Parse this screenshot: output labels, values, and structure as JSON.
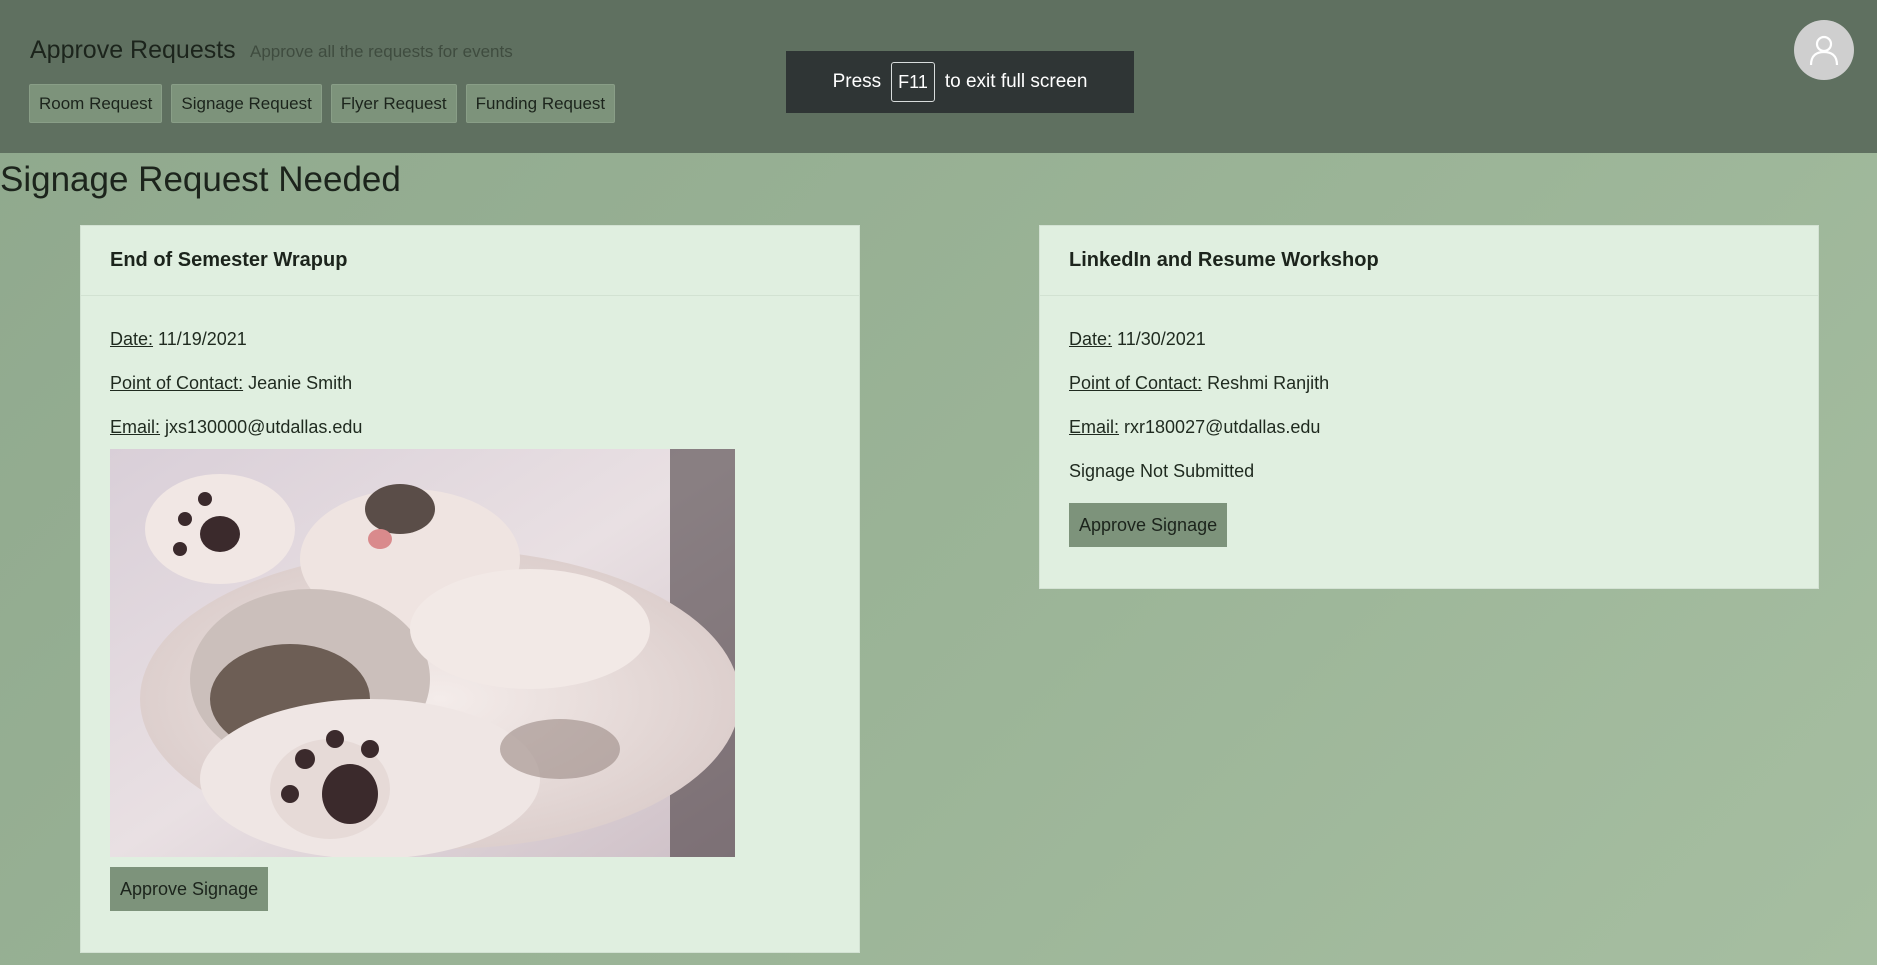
{
  "header": {
    "title": "Approve Requests",
    "subtitle": "Approve all the requests for events",
    "nav": [
      {
        "label": "Room Request"
      },
      {
        "label": "Signage Request"
      },
      {
        "label": "Flyer Request"
      },
      {
        "label": "Funding Request"
      }
    ],
    "avatar_icon": "user-icon"
  },
  "fullscreen_toast": {
    "prefix": "Press",
    "key": "F11",
    "suffix": "to exit full screen"
  },
  "page_title": "Signage Request Needed",
  "labels": {
    "date": "Date:",
    "contact": "Point of Contact:",
    "email": "Email:"
  },
  "requests": [
    {
      "title": "End of Semester Wrapup",
      "date": "11/19/2021",
      "contact": "Jeanie Smith",
      "email": "jxs130000@utdallas.edu",
      "approve_label": "Approve Signage"
    },
    {
      "title": "LinkedIn and Resume Workshop",
      "date": "11/30/2021",
      "contact": "Reshmi Ranjith",
      "email": "rxr180027@utdallas.edu",
      "status": "Signage Not Submitted",
      "approve_label": "Approve Signage"
    }
  ],
  "colors": {
    "header_bg": "#5f7060",
    "button_bg": "#7d937b",
    "card_bg": "#e0efe0",
    "page_bg": "#9bb497"
  }
}
